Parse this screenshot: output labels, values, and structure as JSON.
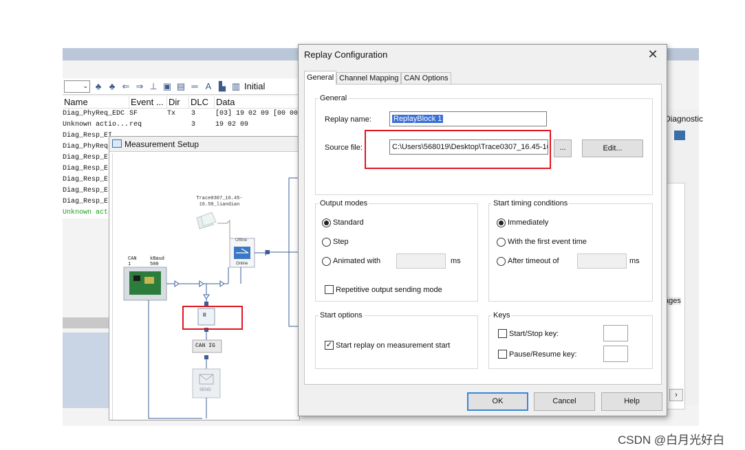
{
  "background_app": {
    "toolbar_label": "Initial",
    "trace_columns": [
      "Name",
      "Event ...",
      "Dir",
      "DLC",
      "Data"
    ],
    "trace_rows": [
      {
        "name": "Diag_PhyReq_EDC",
        "event": "SF",
        "dir": "Tx",
        "dlc": "3",
        "data": "[03] 19 02 09 [00 00 (",
        "highlight": false
      },
      {
        "name": "Unknown actio...",
        "event": "req",
        "dir": "",
        "dlc": "3",
        "data": "19 02 09",
        "highlight": false
      },
      {
        "name": "Diag_Resp_EI",
        "event": "",
        "dir": "",
        "dlc": "",
        "data": "",
        "highlight": false
      },
      {
        "name": "Diag_PhyReq",
        "event": "",
        "dir": "",
        "dlc": "",
        "data": "",
        "highlight": false
      },
      {
        "name": "Diag_Resp_EI",
        "event": "",
        "dir": "",
        "dlc": "",
        "data": "",
        "highlight": false
      },
      {
        "name": "Diag_Resp_EI",
        "event": "",
        "dir": "",
        "dlc": "",
        "data": "",
        "highlight": false
      },
      {
        "name": "Diag_Resp_EI",
        "event": "",
        "dir": "",
        "dlc": "",
        "data": "",
        "highlight": false
      },
      {
        "name": "Diag_Resp_EI",
        "event": "",
        "dir": "",
        "dlc": "",
        "data": "",
        "highlight": false
      },
      {
        "name": "Diag_Resp_EI",
        "event": "",
        "dir": "",
        "dlc": "",
        "data": "",
        "highlight": false
      },
      {
        "name": "Unknown acti",
        "event": "",
        "dir": "",
        "dlc": "",
        "data": "",
        "highlight": true
      }
    ],
    "right_labels": {
      "diagnostics": "Diagnostic",
      "messages": "ages"
    }
  },
  "measurement_setup": {
    "title": "Measurement Setup",
    "trace_file_label_1": "Trace0307_16.45-",
    "trace_file_label_2": "16.50_liandian",
    "offline_label": "Offline",
    "online_label": "Online",
    "can_label": "CAN",
    "can_number": "1",
    "kbaud_label": "kBaud",
    "kbaud_value": "500",
    "replay_block_label": "R",
    "can_ig_label": "CAN IG",
    "send_label": "SEND"
  },
  "dialog": {
    "title": "Replay Configuration",
    "tabs": [
      "General",
      "Channel Mapping",
      "CAN Options"
    ],
    "general_group": "General",
    "replay_name_label": "Replay name:",
    "replay_name_value": "ReplayBlock 1",
    "source_file_label": "Source file:",
    "source_file_value": "C:\\Users\\568019\\Desktop\\Trace0307_16.45-16.",
    "browse_label": "...",
    "edit_label": "Edit...",
    "output_modes": {
      "title": "Output modes",
      "standard": "Standard",
      "step": "Step",
      "animated": "Animated with",
      "ms": "ms",
      "repetitive": "Repetitive output sending mode"
    },
    "start_timing": {
      "title": "Start timing conditions",
      "immediately": "Immediately",
      "first_event": "With the first event time",
      "after_timeout": "After timeout of",
      "ms": "ms"
    },
    "start_options": {
      "title": "Start options",
      "start_replay": "Start replay on measurement start"
    },
    "keys": {
      "title": "Keys",
      "start_stop": "Start/Stop key:",
      "pause_resume": "Pause/Resume key:"
    },
    "ok_label": "OK",
    "cancel_label": "Cancel",
    "help_label": "Help"
  },
  "watermark": "CSDN @白月光好白",
  "colors": {
    "highlight_red": "#e0141e",
    "selection_blue": "#3a6fd8",
    "default_button_border": "#3a85d8"
  }
}
